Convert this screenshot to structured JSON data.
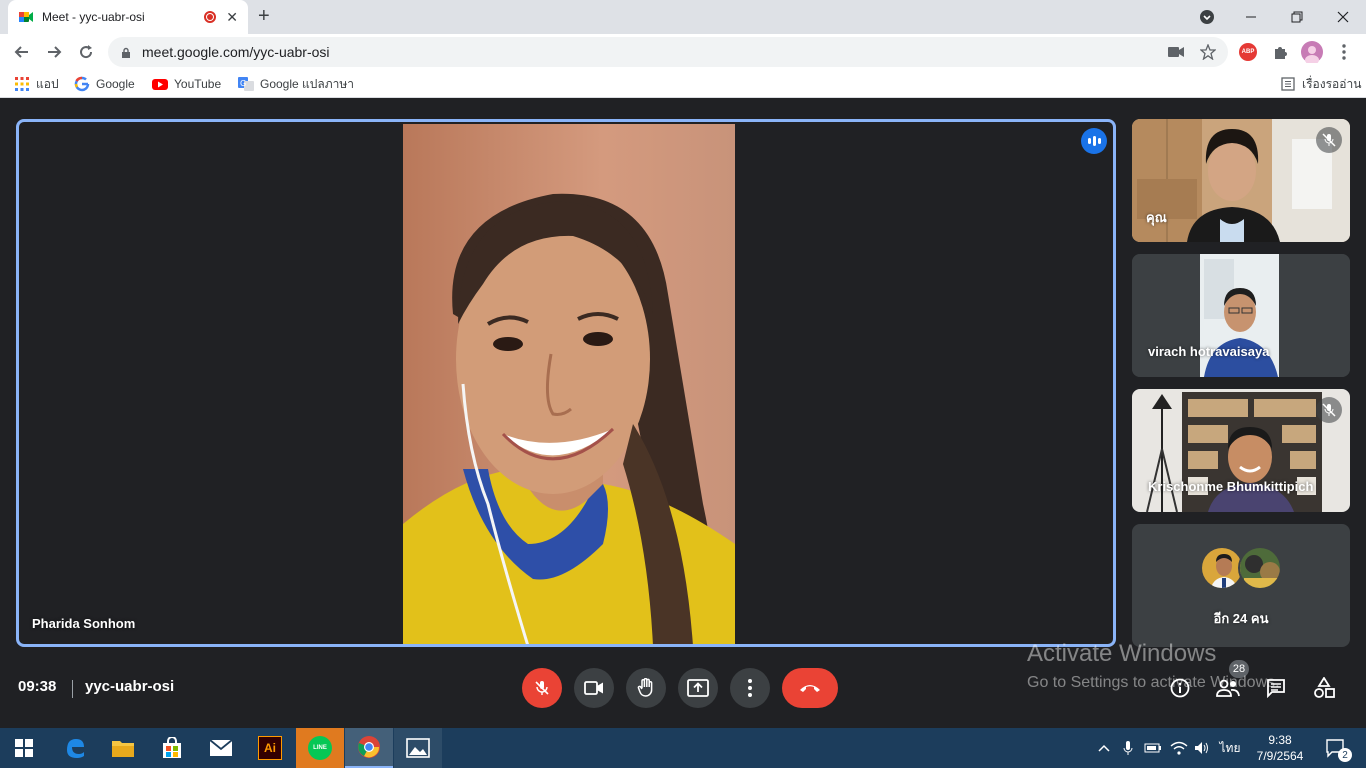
{
  "browser": {
    "tab_title": "Meet - yyc-uabr-osi",
    "url": "meet.google.com/yyc-uabr-osi",
    "profile_badge": "ABP",
    "bookmarks": [
      {
        "label": "แอป",
        "icon": "apps-grid-icon"
      },
      {
        "label": "Google",
        "icon": "google-icon"
      },
      {
        "label": "YouTube",
        "icon": "youtube-icon"
      },
      {
        "label": "Google แปลภาษา",
        "icon": "google-translate-icon"
      }
    ],
    "reading_list": "เรื่องรออ่าน"
  },
  "meet": {
    "main_participant": "Pharida Sonhom",
    "participants": [
      {
        "name": "คุณ",
        "muted": true
      },
      {
        "name": "virach hotravaisaya",
        "muted": false
      },
      {
        "name": "Krischonme Bhumkittipich",
        "muted": true
      }
    ],
    "more_participants": "อีก 24 คน",
    "time": "09:38",
    "meeting_code": "yyc-uabr-osi",
    "people_count": "28"
  },
  "watermark": {
    "title": "Activate Windows",
    "subtitle": "Go to Settings to activate Windows."
  },
  "taskbar": {
    "time": "9:38",
    "date": "7/9/2564",
    "language": "ไทย",
    "notifications": "2",
    "illustrator_label": "Ai",
    "line_label": "LINE"
  },
  "colors": {
    "accent_blue": "#8ab4f8",
    "meet_bg": "#202124",
    "red": "#ea4335"
  }
}
